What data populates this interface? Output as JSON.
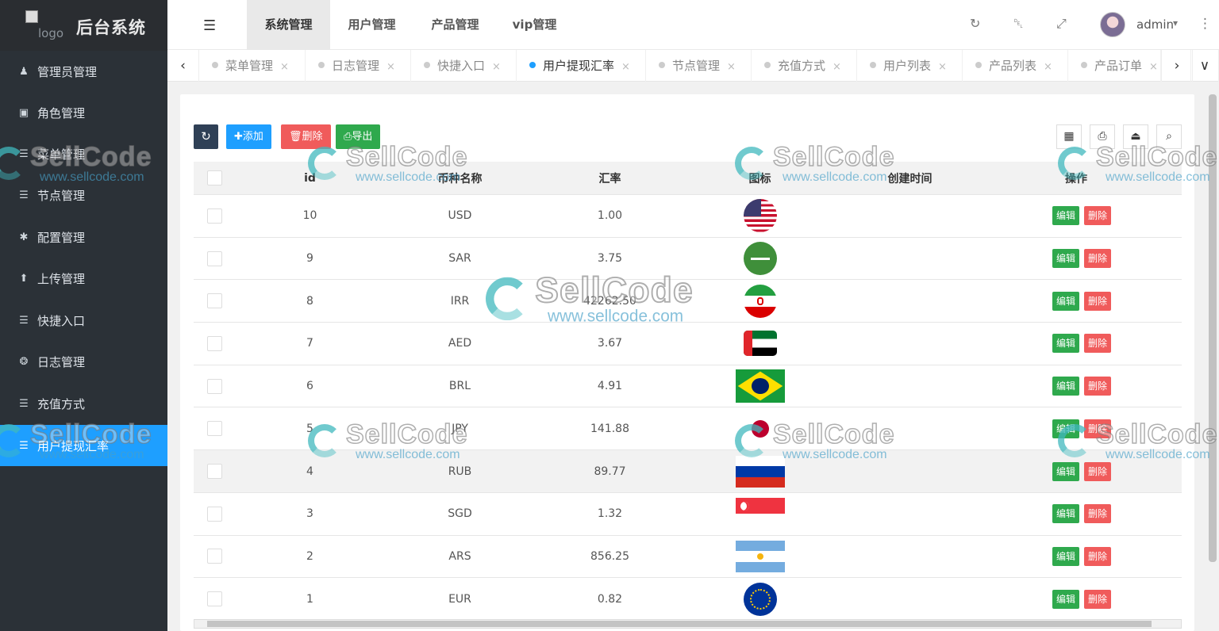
{
  "brand": {
    "logo_alt": "logo",
    "title": "后台系统"
  },
  "sidebar": {
    "items": [
      {
        "label": "管理员管理",
        "icon": "user-icon",
        "glyph": "♟"
      },
      {
        "label": "角色管理",
        "icon": "role-icon",
        "glyph": "▣"
      },
      {
        "label": "菜单管理",
        "icon": "menu-icon",
        "glyph": "☰"
      },
      {
        "label": "节点管理",
        "icon": "list-icon",
        "glyph": "☰"
      },
      {
        "label": "配置管理",
        "icon": "asterisk-icon",
        "glyph": "✱"
      },
      {
        "label": "上传管理",
        "icon": "upload-icon",
        "glyph": "⬆"
      },
      {
        "label": "快捷入口",
        "icon": "list-icon",
        "glyph": "☰"
      },
      {
        "label": "日志管理",
        "icon": "log-icon",
        "glyph": "❂"
      },
      {
        "label": "充值方式",
        "icon": "list-icon",
        "glyph": "☰"
      },
      {
        "label": "用户提现汇率",
        "icon": "list-icon",
        "glyph": "☰",
        "active": true
      }
    ]
  },
  "topbar": {
    "toggle_icon": "☰",
    "tabs": [
      {
        "label": "系统管理",
        "active": true
      },
      {
        "label": "用户管理"
      },
      {
        "label": "产品管理"
      },
      {
        "label": "vip管理"
      }
    ],
    "icons": {
      "refresh": "↻",
      "trash": "␡",
      "fullscreen": "⤢",
      "more": "⋮",
      "caret": "▾"
    },
    "user": "admin"
  },
  "page_tabs": {
    "prev": "‹",
    "next": "›",
    "dropdown": "∨",
    "close": "×",
    "items": [
      {
        "label": "菜单管理"
      },
      {
        "label": "日志管理"
      },
      {
        "label": "快捷入口"
      },
      {
        "label": "用户提现汇率",
        "active": true
      },
      {
        "label": "节点管理"
      },
      {
        "label": "充值方式"
      },
      {
        "label": "用户列表"
      },
      {
        "label": "产品列表"
      },
      {
        "label": "产品订单"
      }
    ]
  },
  "toolbar": {
    "refresh_icon": "↻",
    "add_label": "✚添加",
    "delete_label": "🗑删除",
    "export_label": "⎙导出",
    "right_icons": [
      "▦",
      "⎙",
      "⏏",
      "⌕"
    ]
  },
  "table": {
    "columns": {
      "id": "id",
      "name": "币种名称",
      "rate": "汇率",
      "icon": "图标",
      "created": "创建时间",
      "ops": "操作"
    },
    "edit_label": "编辑",
    "delete_label": "删除",
    "rows": [
      {
        "id": "10",
        "name": "USD",
        "rate": "1.00",
        "flag": "us"
      },
      {
        "id": "9",
        "name": "SAR",
        "rate": "3.75",
        "flag": "sa"
      },
      {
        "id": "8",
        "name": "IRR",
        "rate": "42262.50",
        "flag": "ir"
      },
      {
        "id": "7",
        "name": "AED",
        "rate": "3.67",
        "flag": "ae"
      },
      {
        "id": "6",
        "name": "BRL",
        "rate": "4.91",
        "flag": "br"
      },
      {
        "id": "5",
        "name": "JPY",
        "rate": "141.88",
        "flag": "jp"
      },
      {
        "id": "4",
        "name": "RUB",
        "rate": "89.77",
        "flag": "ru"
      },
      {
        "id": "3",
        "name": "SGD",
        "rate": "1.32",
        "flag": "sg"
      },
      {
        "id": "2",
        "name": "ARS",
        "rate": "856.25",
        "flag": "ar"
      },
      {
        "id": "1",
        "name": "EUR",
        "rate": "0.82",
        "flag": "eu"
      }
    ]
  },
  "watermark": {
    "brand": "SellCode",
    "url": "www.sellcode.com"
  }
}
